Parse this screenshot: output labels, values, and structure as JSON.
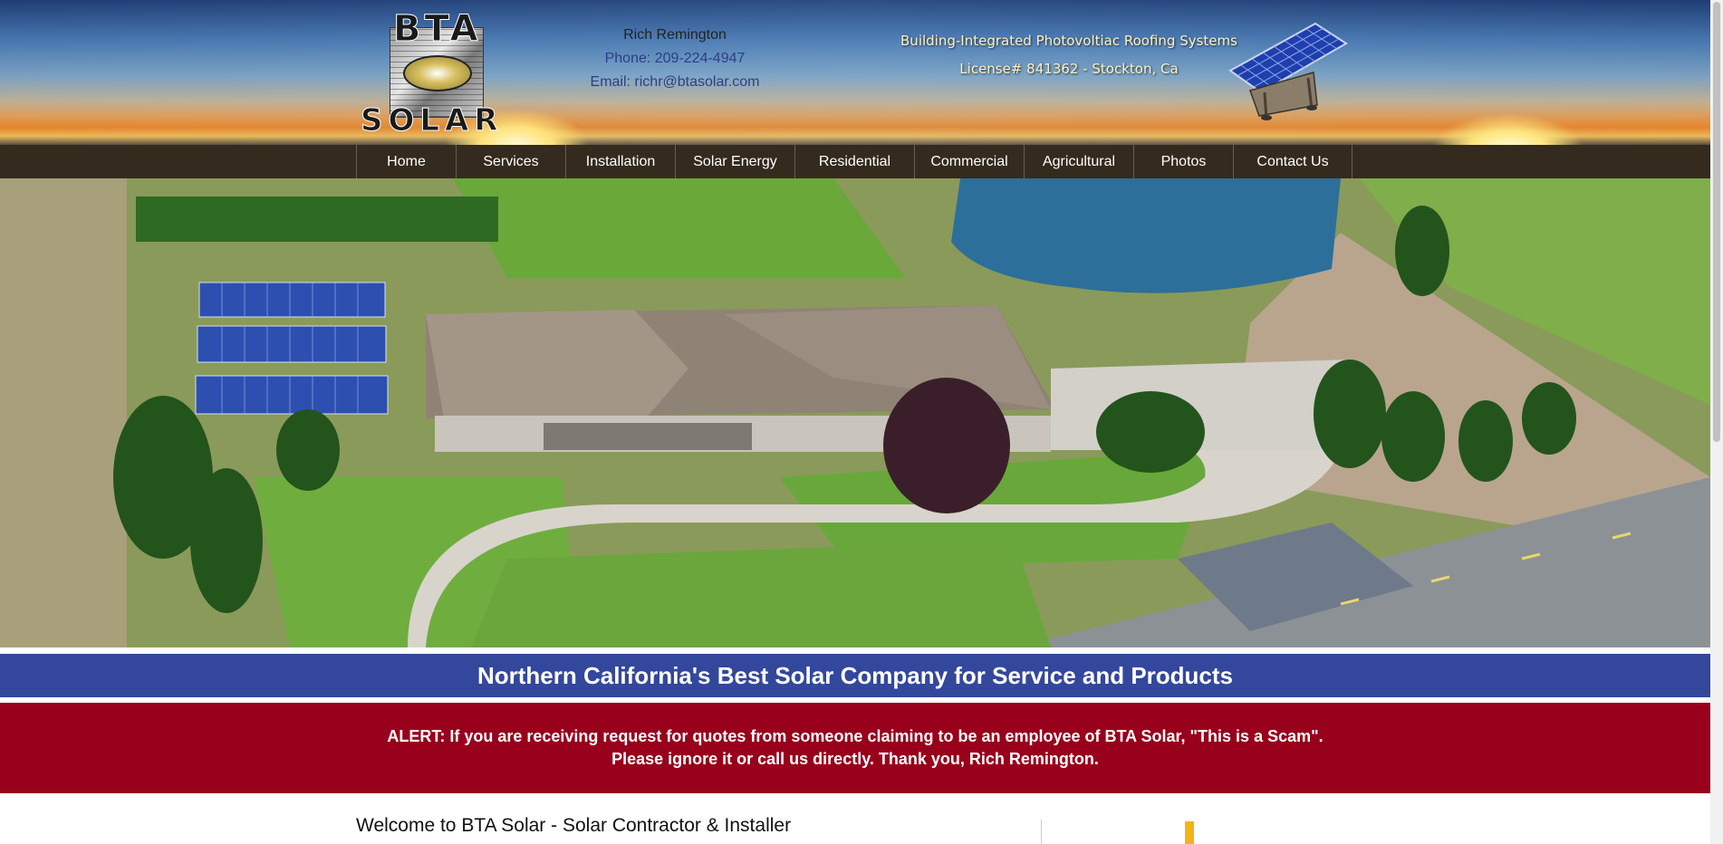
{
  "header": {
    "logo": {
      "top_text": "BTA",
      "bottom_text": "SOLAR"
    },
    "contact": {
      "name": "Rich Remington",
      "phone": "Phone: 209-224-4947",
      "email": "Email: richr@btasolar.com"
    },
    "tagline": "Building-Integrated Photovoltiac Roofing Systems",
    "license": "License# 841362 - Stockton, Ca"
  },
  "nav": {
    "items": [
      {
        "label": "Home"
      },
      {
        "label": "Services"
      },
      {
        "label": "Installation"
      },
      {
        "label": "Solar Energy"
      },
      {
        "label": "Residential"
      },
      {
        "label": "Commercial"
      },
      {
        "label": "Agricultural"
      },
      {
        "label": "Photos"
      },
      {
        "label": "Contact Us"
      }
    ]
  },
  "banner": {
    "headline": "Northern California's Best Solar Company for Service and Products"
  },
  "alert": {
    "text": "ALERT: If you are receiving request for quotes from someone claiming to be an employee of BTA Solar, \"This is a Scam\". Please ignore it or call us directly. Thank you, Rich Remington."
  },
  "content": {
    "welcome_heading": "Welcome to BTA Solar - Solar Contractor & Installer"
  },
  "colors": {
    "nav_bg": "#342a1e",
    "banner_blue": "#33479c",
    "alert_red": "#98001b",
    "contact_blue": "#2c3f86",
    "tagline_cream": "#fbf2c6"
  },
  "icons": {
    "panel": "solar-panel-icon"
  }
}
